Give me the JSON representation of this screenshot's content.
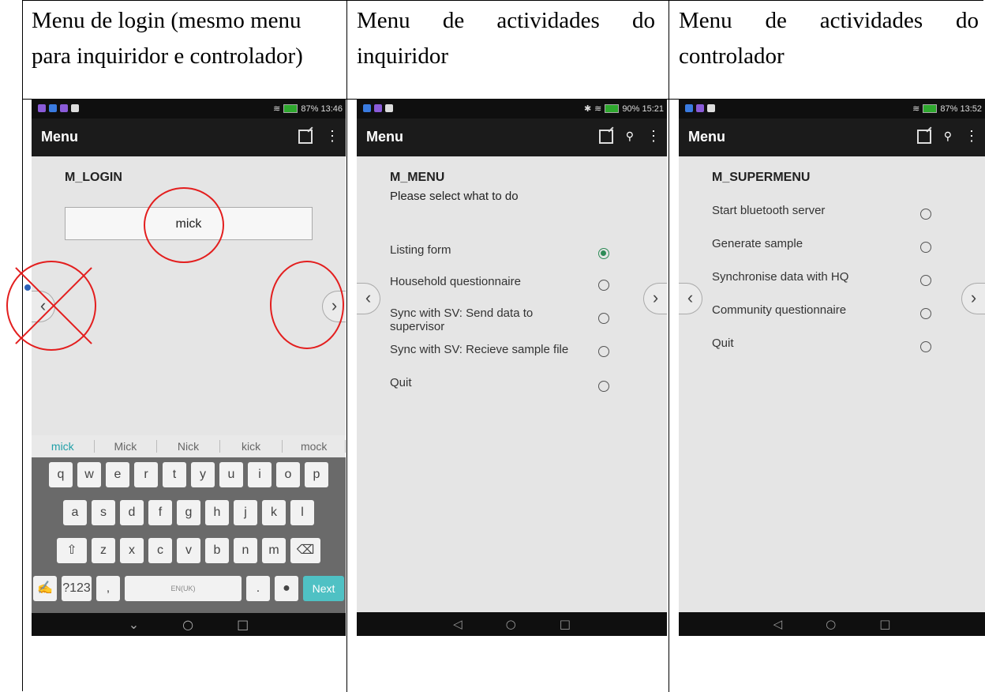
{
  "captions": {
    "login": {
      "line1": [
        "Menu de login (mesmo menu"
      ],
      "line2": "para inquiridor e controlador)"
    },
    "inquiridor": {
      "line1": [
        "Menu",
        "de",
        "actividades",
        "do"
      ],
      "line2": "inquiridor"
    },
    "controlador": {
      "line1": [
        "Menu",
        "de",
        "actividades",
        "do"
      ],
      "line2": "controlador"
    }
  },
  "phones": {
    "login": {
      "status": {
        "right": "87% 13:46"
      },
      "appbar": {
        "title": "Menu"
      },
      "qname": "M_LOGIN",
      "input_value": "mick",
      "suggestions": [
        "mick",
        "Mick",
        "Nick",
        "kick",
        "mock"
      ],
      "keys_row1": [
        "q",
        "w",
        "e",
        "r",
        "t",
        "y",
        "u",
        "i",
        "o",
        "p"
      ],
      "keys_row2": [
        "a",
        "s",
        "d",
        "f",
        "g",
        "h",
        "j",
        "k",
        "l"
      ],
      "keys_row3": [
        "⇧",
        "z",
        "x",
        "c",
        "v",
        "b",
        "n",
        "m",
        "⌫"
      ],
      "key_symbols": "?123",
      "key_space": "EN(UK)",
      "key_next": "Next"
    },
    "inquiridor": {
      "status": {
        "right": "90% 15:21"
      },
      "appbar": {
        "title": "Menu"
      },
      "qname": "M_MENU",
      "qtext": "Please select what to do",
      "options": [
        "Listing form",
        "Household questionnaire",
        "Sync with SV: Send data to supervisor",
        "Sync with SV: Recieve sample file",
        "Quit"
      ]
    },
    "controlador": {
      "status": {
        "right": "87% 13:52"
      },
      "appbar": {
        "title": "Menu"
      },
      "qname": "M_SUPERMENU",
      "options": [
        "Start bluetooth server",
        "Generate sample",
        "Synchronise data with HQ",
        "Community questionnaire",
        "Quit"
      ]
    }
  },
  "colors": {
    "annotation": "#e31e1e",
    "selected_radio": "#2e8b57",
    "keyboard_accent": "#4fc1c4"
  }
}
